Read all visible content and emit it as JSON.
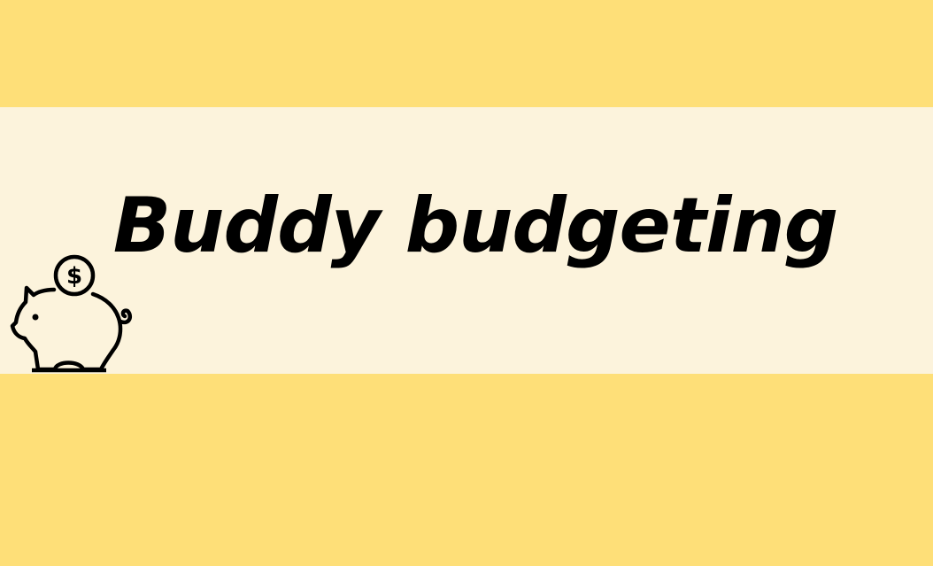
{
  "colors": {
    "background": "#FEDF78",
    "band": "#FCF3DC",
    "text": "#000000",
    "icon_stroke": "#000000"
  },
  "header": {
    "title": "Buddy budgeting"
  },
  "icon": {
    "name": "piggy-bank-icon",
    "coin_symbol": "$"
  }
}
